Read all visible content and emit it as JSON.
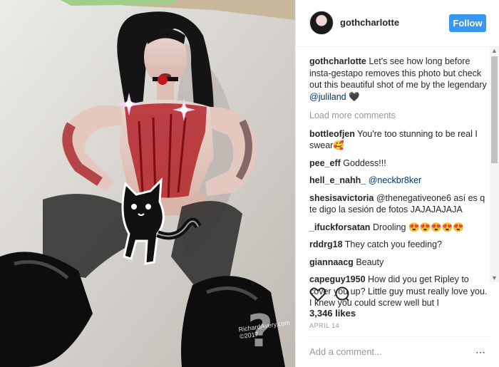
{
  "post": {
    "username": "gothcharlotte",
    "follow_label": "Follow",
    "caption": {
      "user": "gothcharlotte",
      "text": "Let's see how long before insta-gestapo removes this photo but check out this beautiful shot of me by the legendary",
      "mention": "@juliland",
      "emoji": "🖤"
    },
    "load_more_label": "Load more comments",
    "comments": [
      {
        "user": "bottleofjen",
        "text": "You're too stunning to be real I swear🥰"
      },
      {
        "user": "pee_eff",
        "text": "Goddess!!!"
      },
      {
        "user": "hell_e_nahh_",
        "text": "@neckbr8ker"
      },
      {
        "user": "shesisavictoria",
        "text": "@thenegativeone6 así es q te digo la sesión de fotos JAJAJAJAJA"
      },
      {
        "user": "_ifuckforsatan",
        "text": "Drooling 😍😍😍😍😍"
      },
      {
        "user": "rddrg18",
        "text": "They catch you feeding?"
      },
      {
        "user": "giannaacg",
        "text": "Beauty"
      },
      {
        "user": "capeguy1950",
        "text": "How did you get Ripley to cover you up? Little guy must really love you. I knew you could screw well but I"
      }
    ],
    "likes": "3,346 likes",
    "date": "APRIL 14",
    "add_comment_placeholder": "Add a comment...",
    "more_icon": "⋯"
  },
  "photo": {
    "watermark": "RichardAvery.com ©2017",
    "overlay_glyph": "?"
  },
  "colors": {
    "follow_button": "#3897f0",
    "mention": "#003569",
    "muted": "#999999"
  }
}
